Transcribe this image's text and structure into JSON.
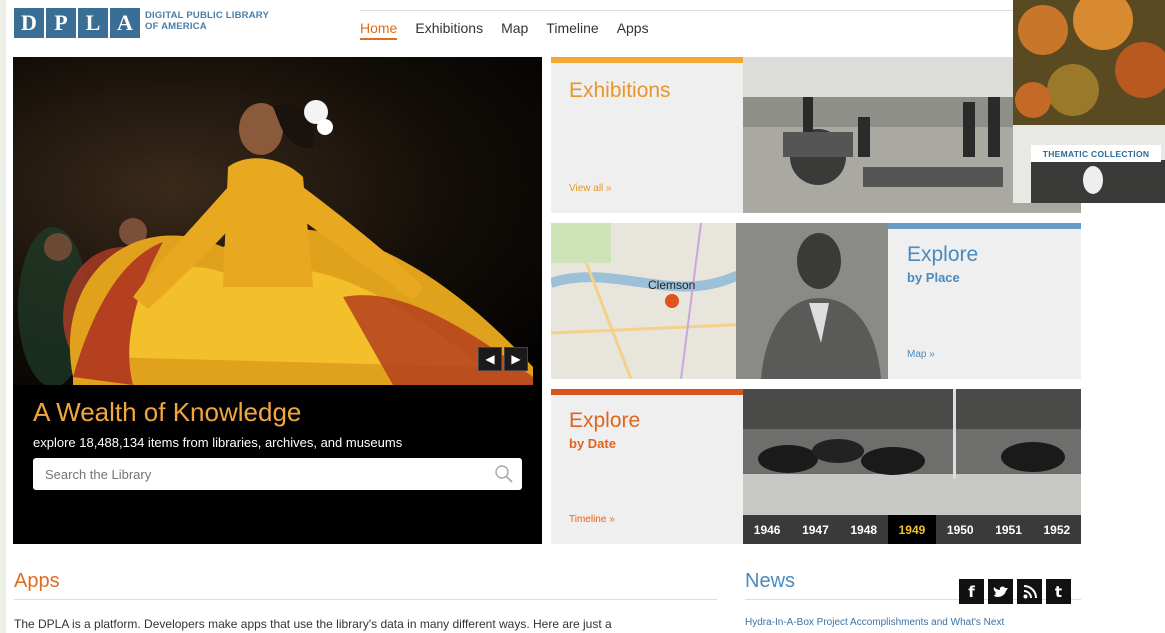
{
  "logo": {
    "letters": [
      "D",
      "P",
      "L",
      "A"
    ],
    "text_line1": "DIGITAL PUBLIC LIBRARY",
    "text_line2": "OF AMERICA"
  },
  "nav": {
    "items": [
      "Home",
      "Exhibitions",
      "Map",
      "Timeline",
      "Apps"
    ],
    "active": "Home"
  },
  "hero": {
    "title": "A Wealth of Knowledge",
    "subtitle": "explore 18,488,134 items from libraries, archives, and museums",
    "search_placeholder": "Search the Library"
  },
  "exhibitions": {
    "title": "Exhibitions",
    "link": "View all »"
  },
  "place": {
    "title": "Explore",
    "subtitle": "by Place",
    "link": "Map »",
    "map_label": "Clemson"
  },
  "date": {
    "title": "Explore",
    "subtitle": "by Date",
    "link": "Timeline »",
    "years": [
      "1946",
      "1947",
      "1948",
      "1949",
      "1950",
      "1951",
      "1952"
    ],
    "selected_year": "1949"
  },
  "thematic": {
    "label": "THEMATIC COLLECTION"
  },
  "apps": {
    "title": "Apps",
    "text": "The DPLA is a platform. Developers make apps that use the library's data in many different ways. Here are just a"
  },
  "news": {
    "title": "News",
    "item": "Hydra-In-A-Box Project Accomplishments and What's Next"
  },
  "social": {
    "facebook": "f",
    "twitter": "t-bird",
    "rss": "rss",
    "tumblr": "t"
  },
  "colors": {
    "orange": "#e06c1e",
    "blue": "#4a8bbf",
    "gold": "#f0a830",
    "logo_blue": "#3b6e95"
  }
}
